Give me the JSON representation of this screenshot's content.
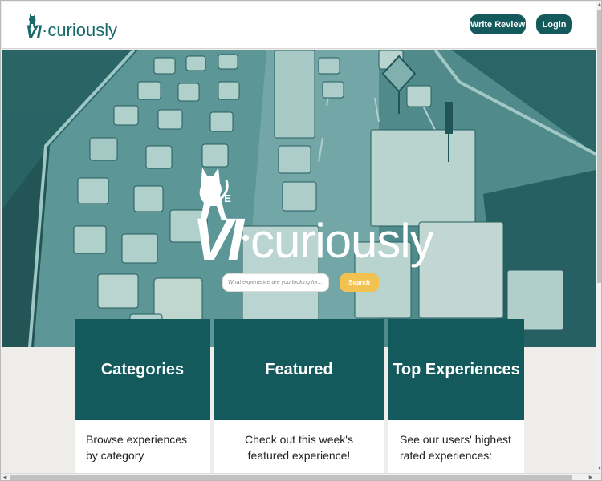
{
  "header": {
    "logo_vi": "VI",
    "logo_text": "·curiously",
    "write_review": "Write Review",
    "login": "Login"
  },
  "hero": {
    "live": "LIVE",
    "vi": "VI",
    "word": "curiously",
    "search_placeholder": "What experience are you looking for...?",
    "search_button": "Search"
  },
  "cards": [
    {
      "title": "Categories",
      "body": "Browse experiences by category"
    },
    {
      "title": "Featured",
      "body": "Check out this week's featured experience!"
    },
    {
      "title": "Top Experiences",
      "body": "See our users' highest rated experiences:"
    }
  ],
  "colors": {
    "brand_teal": "#145a5c",
    "accent_yellow": "#f1c24f",
    "hero_tint": "#2f6f70"
  },
  "icons": {
    "logo": "cat-icon",
    "scroll_up": "scroll-up-arrow-icon",
    "scroll_down": "scroll-down-arrow-icon",
    "scroll_left": "scroll-left-arrow-icon",
    "scroll_right": "scroll-right-arrow-icon"
  }
}
